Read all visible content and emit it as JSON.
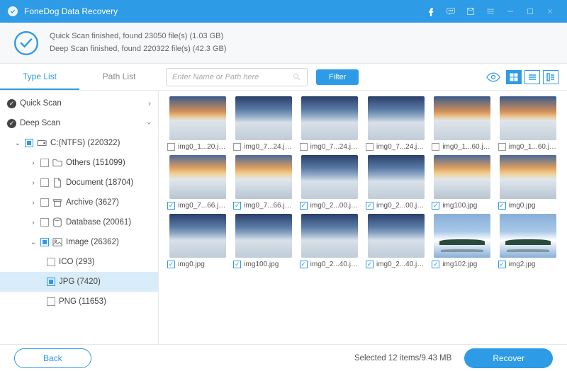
{
  "titlebar": {
    "app_name": "FoneDog Data Recovery"
  },
  "status": {
    "line1": "Quick Scan finished, found 23050 file(s) (1.03 GB)",
    "line2": "Deep Scan finished, found 220322 file(s) (42.3 GB)"
  },
  "tabs": {
    "type_list": "Type List",
    "path_list": "Path List"
  },
  "search": {
    "placeholder": "Enter Name or Path here"
  },
  "filter_label": "Filter",
  "tree": {
    "quick_scan": "Quick Scan",
    "deep_scan": "Deep Scan",
    "drive": "C:(NTFS) (220322)",
    "others": "Others (151099)",
    "document": "Document (18704)",
    "archive": "Archive (3627)",
    "database": "Database (20061)",
    "image": "Image (26362)",
    "ico": "ICO (293)",
    "jpg": "JPG (7420)",
    "png": "PNG (11653)"
  },
  "files": [
    {
      "name": "img0_1...20.jpg",
      "checked": false,
      "v": "v1"
    },
    {
      "name": "img0_7...24.jpg",
      "checked": false,
      "v": "v2"
    },
    {
      "name": "img0_7...24.jpg",
      "checked": false,
      "v": "v2"
    },
    {
      "name": "img0_7...24.jpg",
      "checked": false,
      "v": "v2"
    },
    {
      "name": "img0_1...60.jpg",
      "checked": false,
      "v": "v1"
    },
    {
      "name": "img0_1...60.jpg",
      "checked": false,
      "v": "v1"
    },
    {
      "name": "img0_7...66.jpg",
      "checked": true,
      "v": "v3"
    },
    {
      "name": "img0_7...66.jpg",
      "checked": true,
      "v": "v3"
    },
    {
      "name": "img0_2...00.jpg",
      "checked": true,
      "v": "v2"
    },
    {
      "name": "img0_2...00.jpg",
      "checked": true,
      "v": "v2"
    },
    {
      "name": "img100.jpg",
      "checked": true,
      "v": "v3"
    },
    {
      "name": "img0.jpg",
      "checked": true,
      "v": "v3"
    },
    {
      "name": "img0.jpg",
      "checked": true,
      "v": "v2"
    },
    {
      "name": "img100.jpg",
      "checked": true,
      "v": "v2"
    },
    {
      "name": "img0_2...40.jpg",
      "checked": true,
      "v": "v2"
    },
    {
      "name": "img0_2...40.jpg",
      "checked": true,
      "v": "v2"
    },
    {
      "name": "img102.jpg",
      "checked": true,
      "v": "v4"
    },
    {
      "name": "img2.jpg",
      "checked": true,
      "v": "v4"
    }
  ],
  "footer": {
    "back": "Back",
    "selected": "Selected 12 items/9.43 MB",
    "recover": "Recover"
  }
}
